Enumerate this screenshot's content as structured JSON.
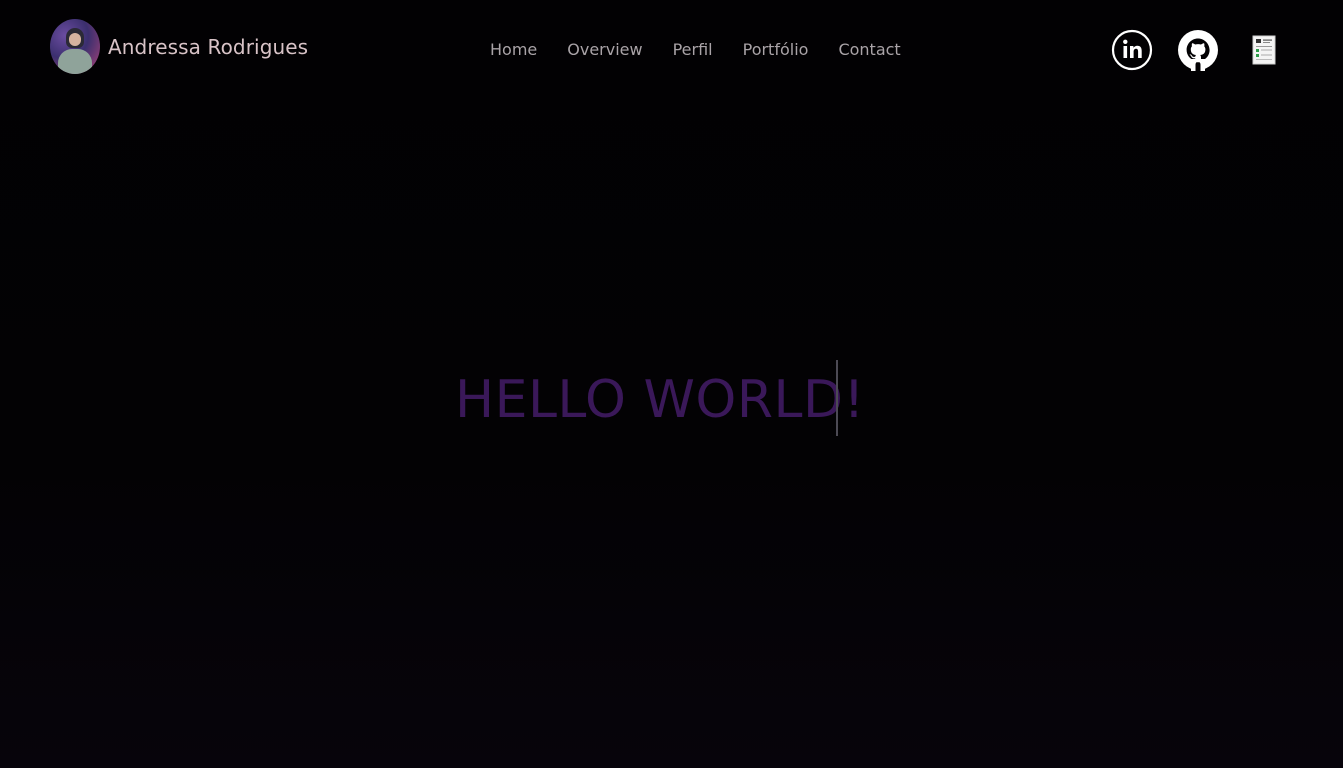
{
  "brand": {
    "name": "Andressa Rodrigues"
  },
  "nav": {
    "items": [
      "Home",
      "Overview",
      "Perfil",
      "Portfólio",
      "Contact"
    ]
  },
  "socials": {
    "icons": [
      "linkedin-icon",
      "github-icon",
      "resume-document-icon"
    ]
  },
  "hero": {
    "typed_text": "HELLO WORLD!"
  },
  "colors": {
    "background": "#030204",
    "hero_text": "#3a1859",
    "brand_text": "#d8c3c7",
    "nav_text": "#a9a3a7"
  }
}
